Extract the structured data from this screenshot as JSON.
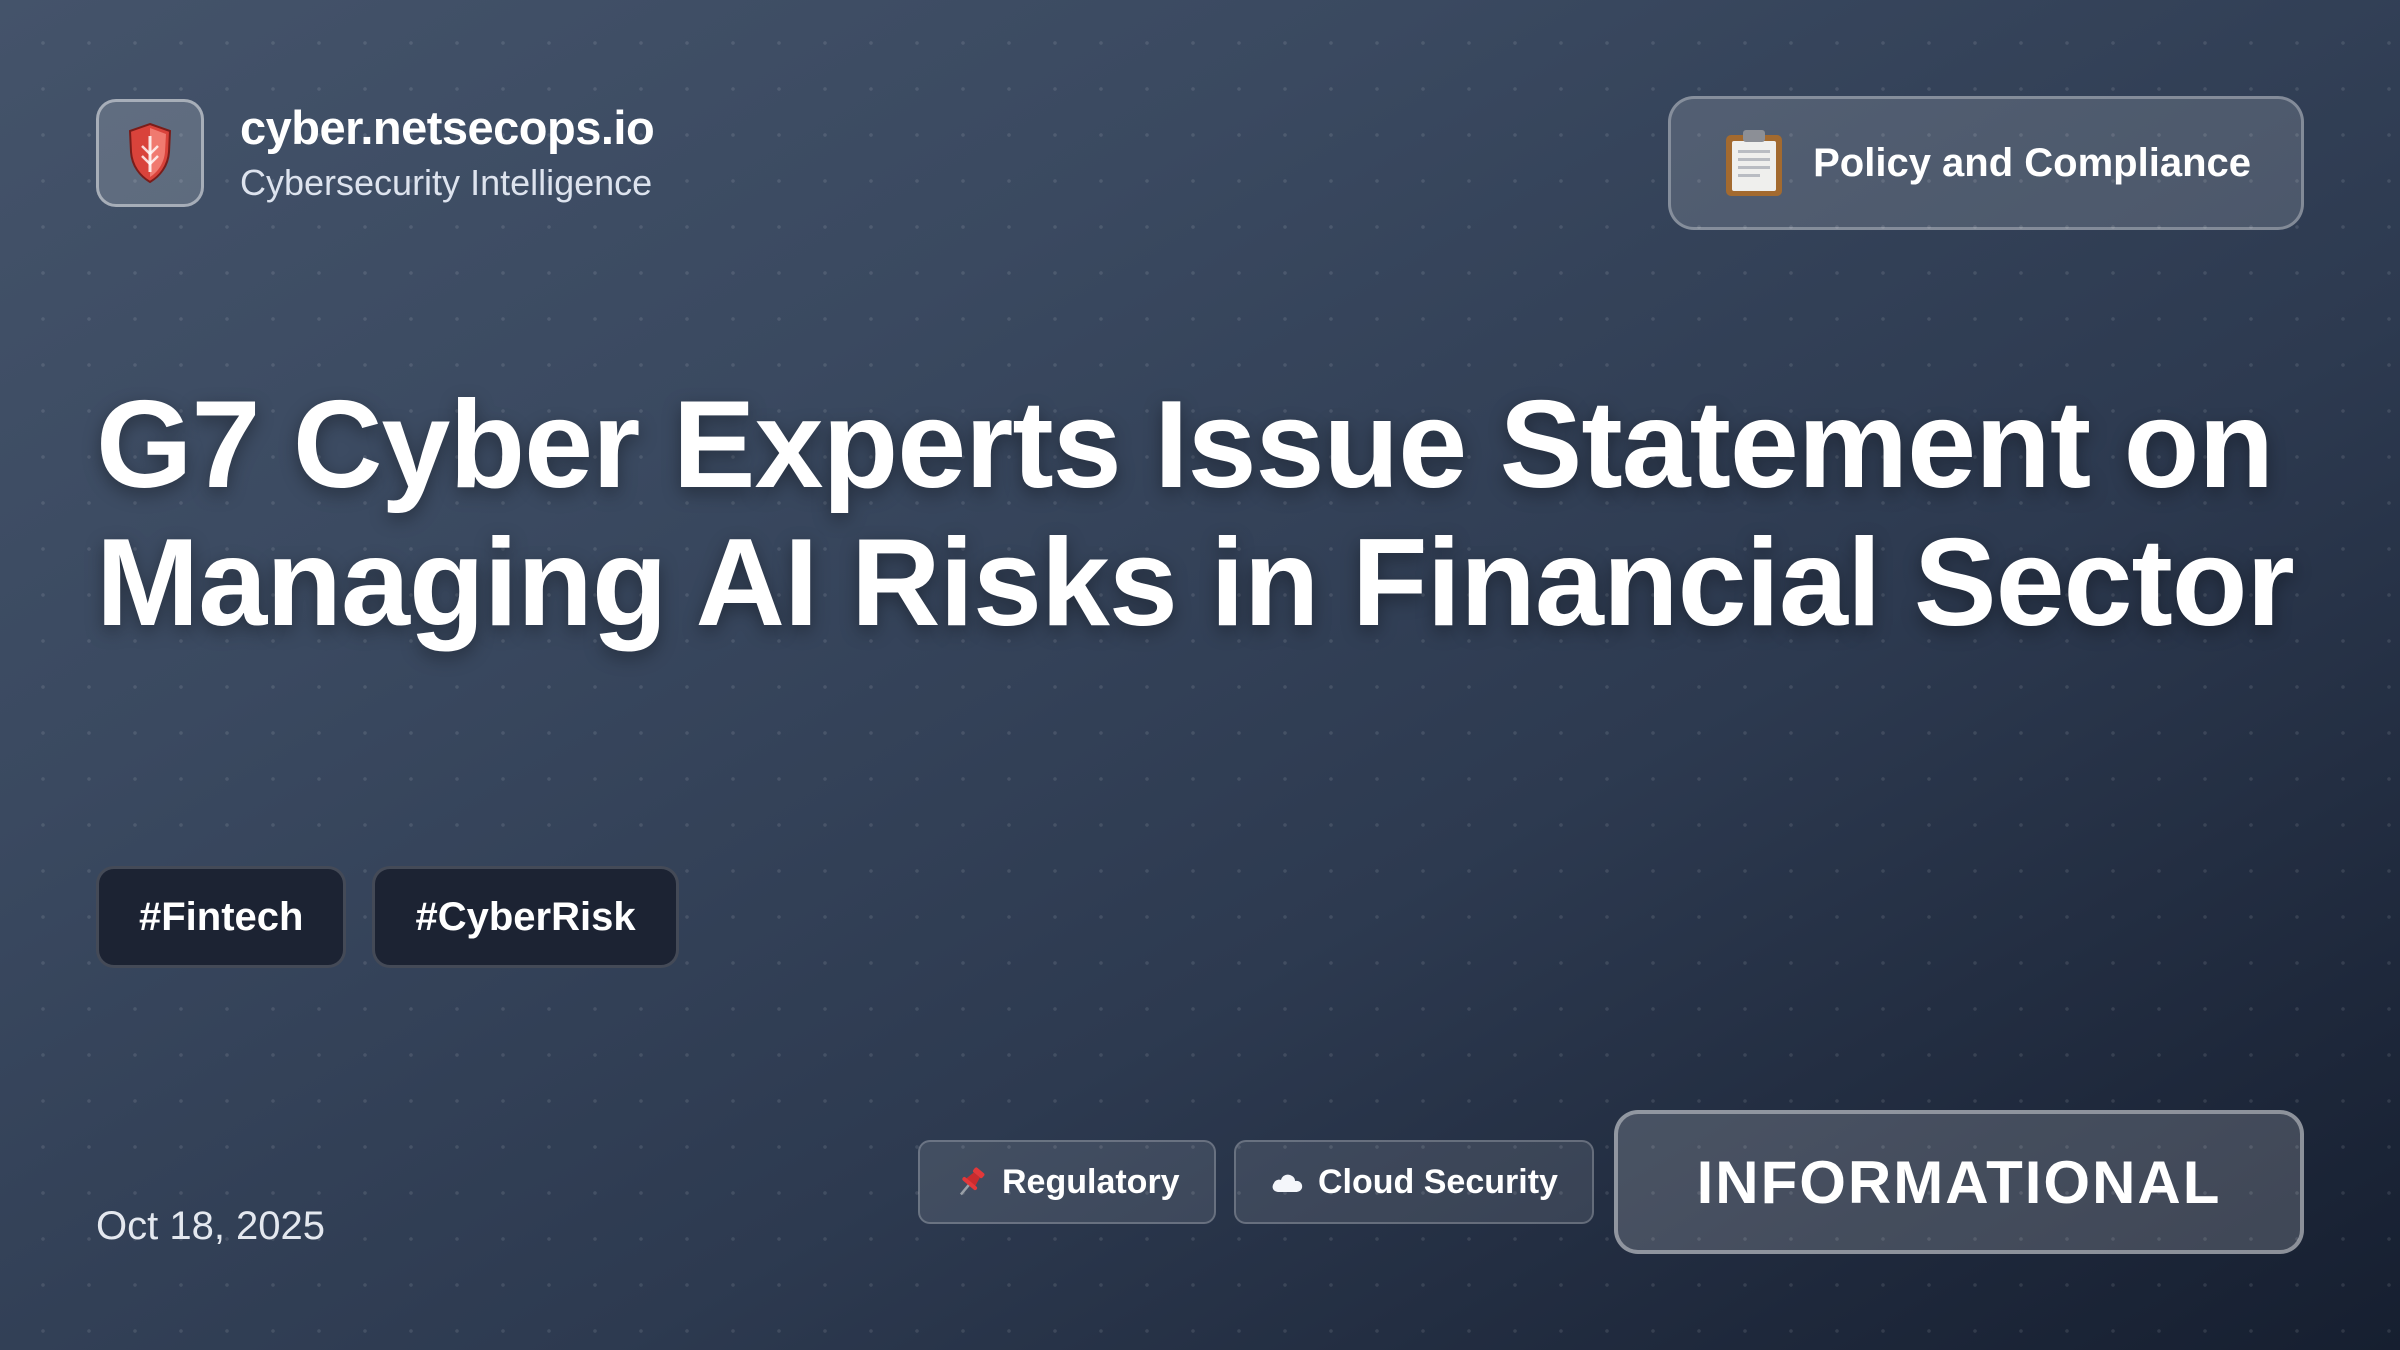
{
  "brand": {
    "logo_icon": "shield-icon",
    "site_name": "cyber.netsecops.io",
    "tagline": "Cybersecurity Intelligence"
  },
  "category": {
    "icon": "clipboard-icon",
    "label": "Policy and Compliance"
  },
  "headline": "G7 Cyber Experts Issue Statement on Managing AI Risks in Financial Sector",
  "hashtags": [
    "#Fintech",
    "#CyberRisk"
  ],
  "date": "Oct 18, 2025",
  "tags": [
    {
      "icon": "pushpin-icon",
      "label": "Regulatory"
    },
    {
      "icon": "cloud-icon",
      "label": "Cloud Security"
    }
  ],
  "severity": "INFORMATIONAL",
  "colors": {
    "background_top": "#44536a",
    "background_bottom": "#161f30",
    "hashtag_bg": "#1c2333",
    "shield_red": "#d9433b"
  }
}
